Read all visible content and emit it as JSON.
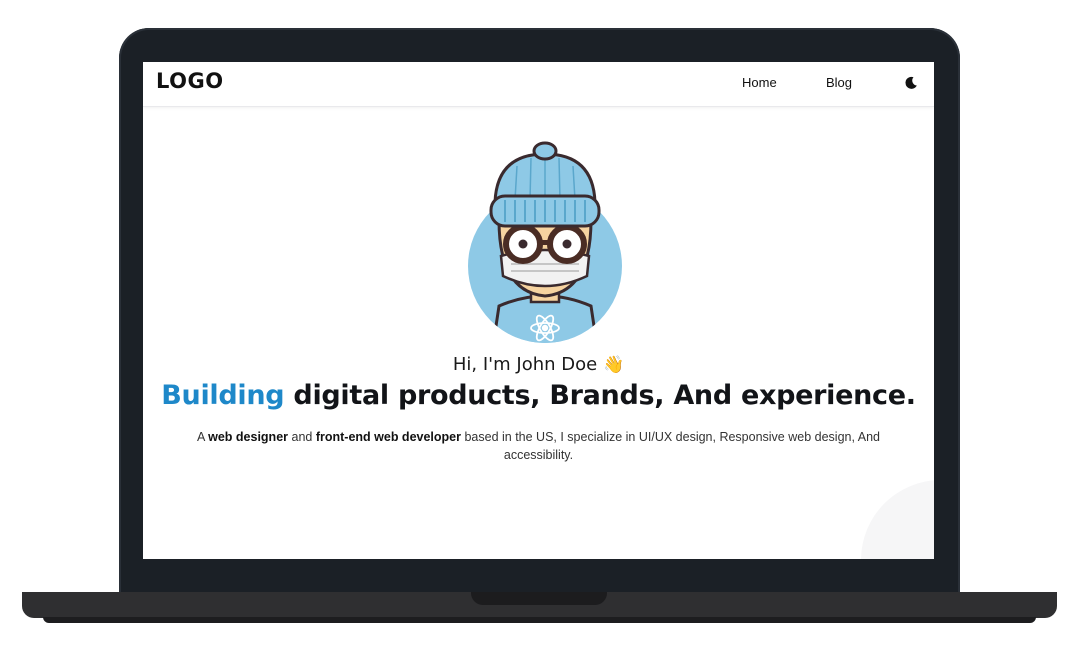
{
  "navbar": {
    "logo": "LOGO",
    "links": [
      {
        "label": "Home"
      },
      {
        "label": "Blog"
      }
    ],
    "theme_toggle_icon": "moon-icon"
  },
  "hero": {
    "avatar_icon": "cartoon-developer-avatar",
    "greeting": "Hi, I'm John Doe",
    "greeting_emoji": "👋",
    "headline_accent": "Building",
    "headline_rest": " digital products, Brands, And experience.",
    "description": {
      "part1": "A ",
      "bold1": "web designer",
      "part2": " and ",
      "bold2": "front-end web developer",
      "part3": " based in the US, I specialize in UI/UX design, Responsive web design, And accessibility."
    }
  },
  "colors": {
    "accent": "#1e88c9",
    "laptop_frame": "#1b2026",
    "avatar_bg": "#8ec9e6"
  }
}
